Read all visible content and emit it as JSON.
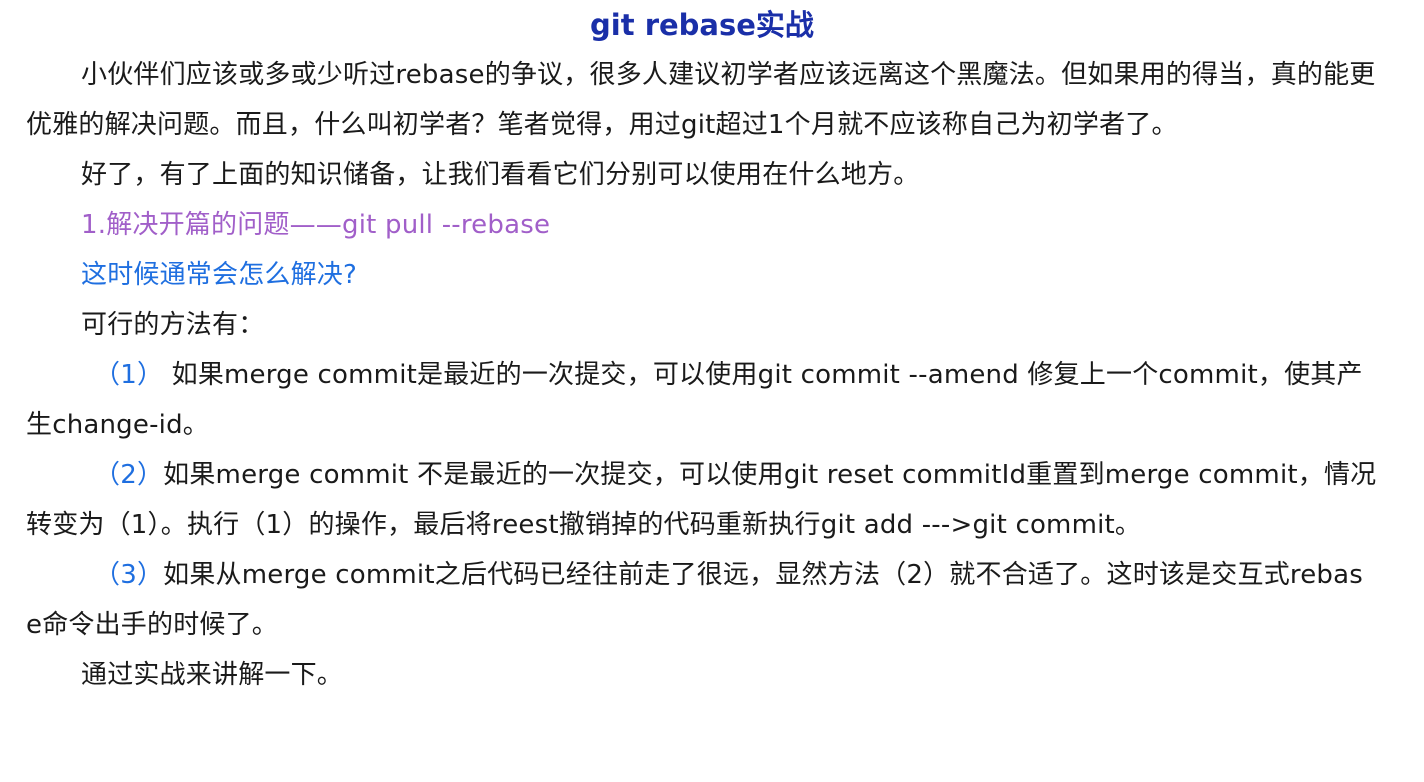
{
  "article": {
    "title": "git rebase实战",
    "p1": "小伙伴们应该或多或少听过rebase的争议，很多人建议初学者应该远离这个黑魔法。但如果用的得当，真的能更优雅的解决问题。而且，什么叫初学者？笔者觉得，用过git超过1个月就不应该称自己为初学者了。",
    "p2": "好了，有了上面的知识储备，让我们看看它们分别可以使用在什么地方。",
    "section_heading": "1.解决开篇的问题——git pull --rebase",
    "question": "这时候通常会怎么解决?",
    "p3": "可行的方法有：",
    "items": [
      {
        "num": "（1）",
        "text": " 如果merge commit是最近的一次提交，可以使用git commit --amend 修复上一个commit，使其产生change-id。"
      },
      {
        "num": "（2）",
        "text": "如果merge commit 不是最近的一次提交，可以使用git reset  commitId重置到merge commit，情况转变为（1）。执行（1）的操作，最后将reest撤销掉的代码重新执行git add --->git commit。"
      },
      {
        "num": "（3）",
        "text": "如果从merge commit之后代码已经往前走了很远，显然方法（2）就不合适了。这时该是交互式rebase命令出手的时候了。"
      }
    ],
    "p4": "通过实战来讲解一下。"
  },
  "colors": {
    "title": "#1a2fa8",
    "section_heading": "#a15fc9",
    "question": "#1f6fe0",
    "item_number": "#1f6fe0",
    "body_text": "#1a1a1a"
  }
}
